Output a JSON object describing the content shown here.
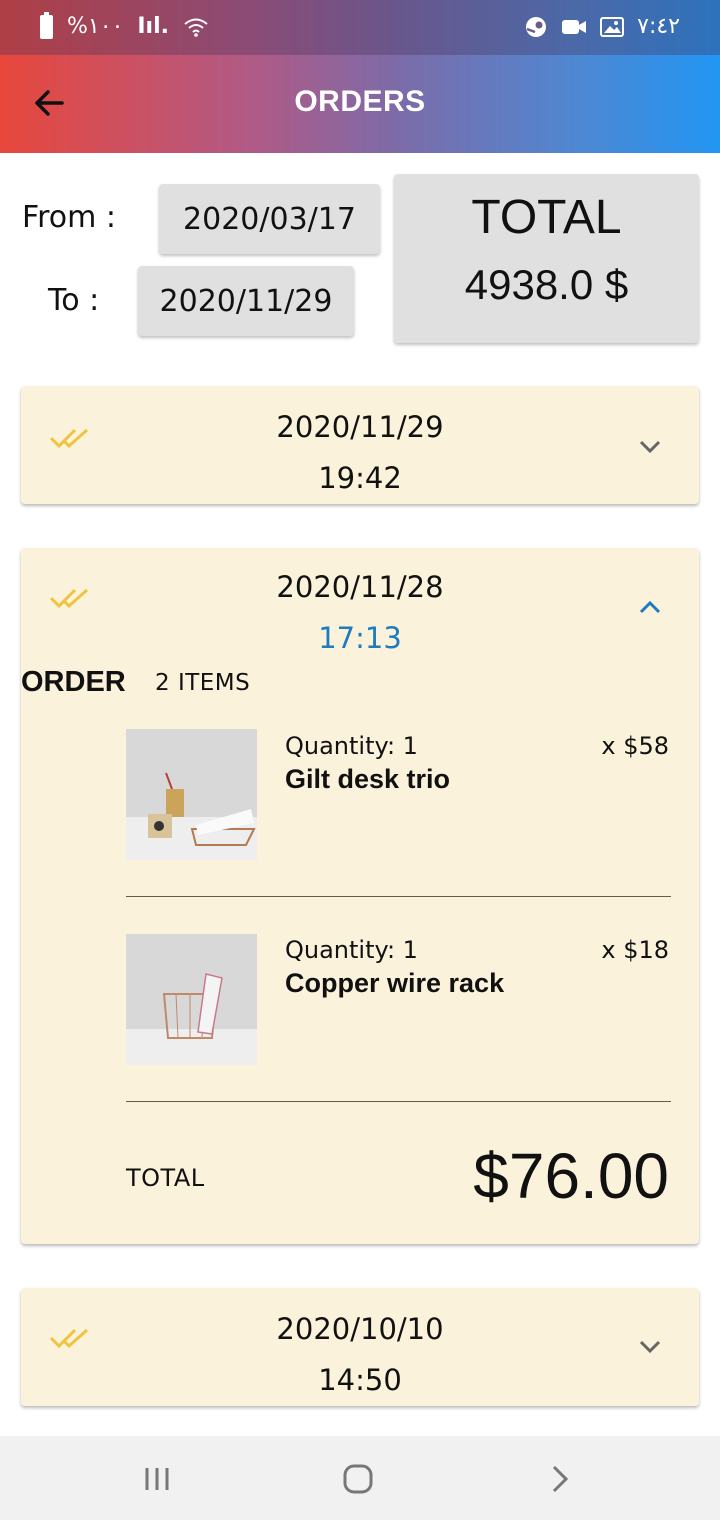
{
  "status": {
    "battery": "%١٠٠",
    "signal": "Iıl.",
    "time": "٧:٤٢"
  },
  "appbar": {
    "title": "ORDERS",
    "back_icon": "arrow-left-icon"
  },
  "filter": {
    "from_label": "From :",
    "from_value": "2020/03/17",
    "to_label": "To :",
    "to_value": "2020/11/29"
  },
  "summary": {
    "total_label": "TOTAL",
    "total_value": "4938.0 $"
  },
  "orders": [
    {
      "date": "2020/11/29",
      "time": "19:42",
      "expanded": false
    },
    {
      "date": "2020/11/28",
      "time": "17:13",
      "expanded": true,
      "order_label": "ORDER",
      "items_count": "2 ITEMS",
      "items": [
        {
          "quantity": "Quantity: 1",
          "name": "Gilt desk trio",
          "price": "x $58"
        },
        {
          "quantity": "Quantity: 1",
          "name": "Copper wire rack",
          "price": "x $18"
        }
      ],
      "total_label": "TOTAL",
      "total": "$76.00"
    },
    {
      "date": "2020/10/10",
      "time": "14:50",
      "expanded": false
    }
  ],
  "colors": {
    "accent_blue": "#1e7bc0",
    "check_yellow": "#f0c341",
    "card_bg": "#fbf2dc"
  }
}
